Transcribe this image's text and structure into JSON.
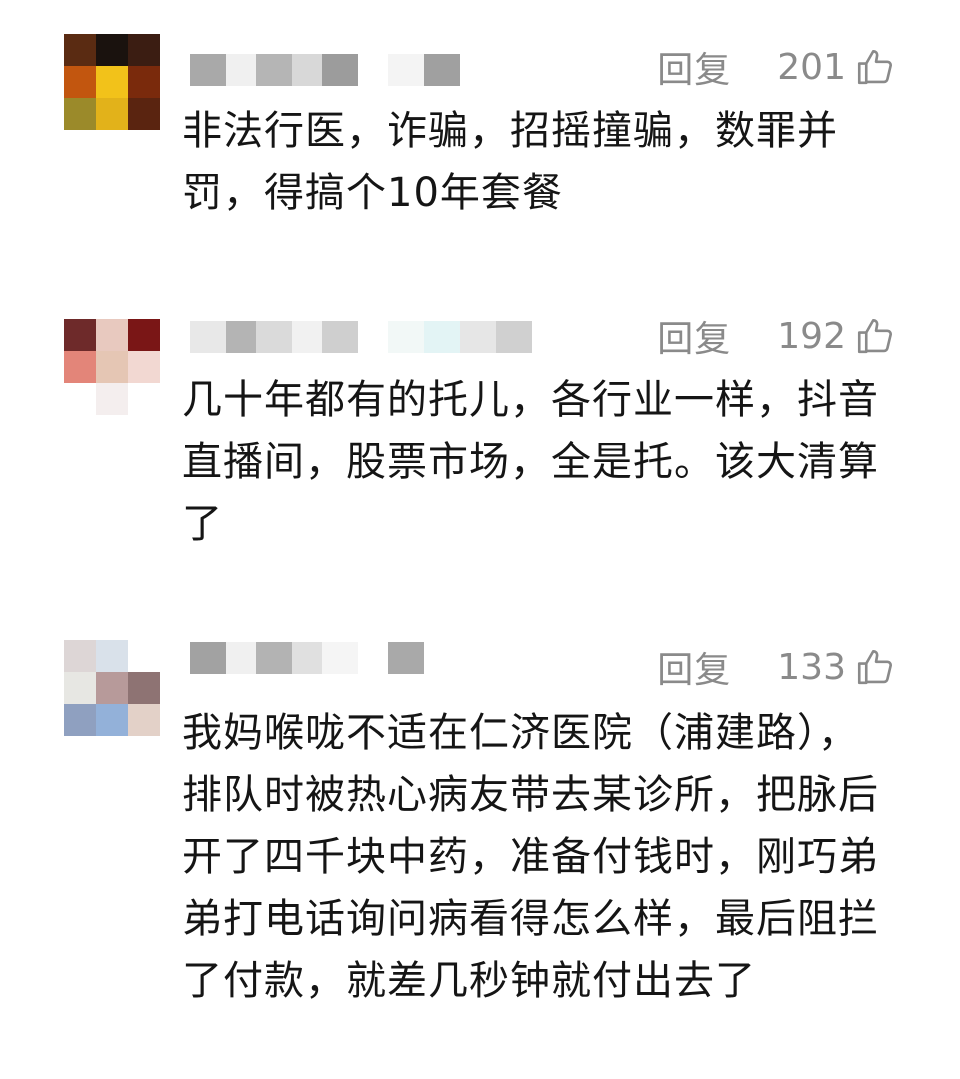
{
  "comments": [
    {
      "reply_label": "回复",
      "likes": "201",
      "text": "非法行医，诈骗，招摇撞骗，数罪并\n罚，得搞个10年套餐",
      "avatar_colors": [
        "#5a2b12",
        "#1a120e",
        "#3b1d12",
        "#c2560f",
        "#f2c21a",
        "#7a2a0c",
        "#9b8a2a",
        "#e2b21a",
        "#5a2410"
      ],
      "name_blocks": [
        "#a9a9a9",
        "#f0f0f0",
        "#b5b5b5",
        "#d8d8d8",
        "#9c9c9c",
        "#ffffff",
        "#f4f4f4",
        "#a0a0a0"
      ]
    },
    {
      "reply_label": "回复",
      "likes": "192",
      "text": "几十年都有的托儿，各行业一样，抖音\n直播间，股票市场，全是托。该大清算\n了",
      "avatar_colors": [
        "#6e2a2a",
        "#e8c9bf",
        "#7a1616",
        "#e38579",
        "#e5c6b4",
        "#f2d8d2",
        "#ffffff",
        "#f4eeee",
        "#ffffff"
      ],
      "name_blocks": [
        "#e8e8e8",
        "#b4b4b4",
        "#dadada",
        "#f1f1f1",
        "#cfcfcf",
        "#ffffff",
        "#f2f8f7",
        "#e3f4f5",
        "#e6e6e6",
        "#d0d0d0"
      ]
    },
    {
      "reply_label": "回复",
      "likes": "133",
      "text": "我妈喉咙不适在仁济医院（浦建路），\n排队时被热心病友带去某诊所，把脉后\n开了四千块中药，准备付钱时，刚巧弟\n弟打电话询问病看得怎么样，最后阻拦\n了付款，就差几秒钟就付出去了",
      "avatar_colors": [
        "#ddd6d6",
        "#d9e1ea",
        "#ffffff",
        "#e7e7e3",
        "#b79a9a",
        "#8e7373",
        "#8fa0c0",
        "#93b1d9",
        "#e3d1c8"
      ],
      "name_blocks": [
        "#a2a2a2",
        "#f0f0f0",
        "#b3b3b3",
        "#e0e0e0",
        "#f5f5f5",
        "#ffffff",
        "#a9a9a9"
      ]
    }
  ]
}
